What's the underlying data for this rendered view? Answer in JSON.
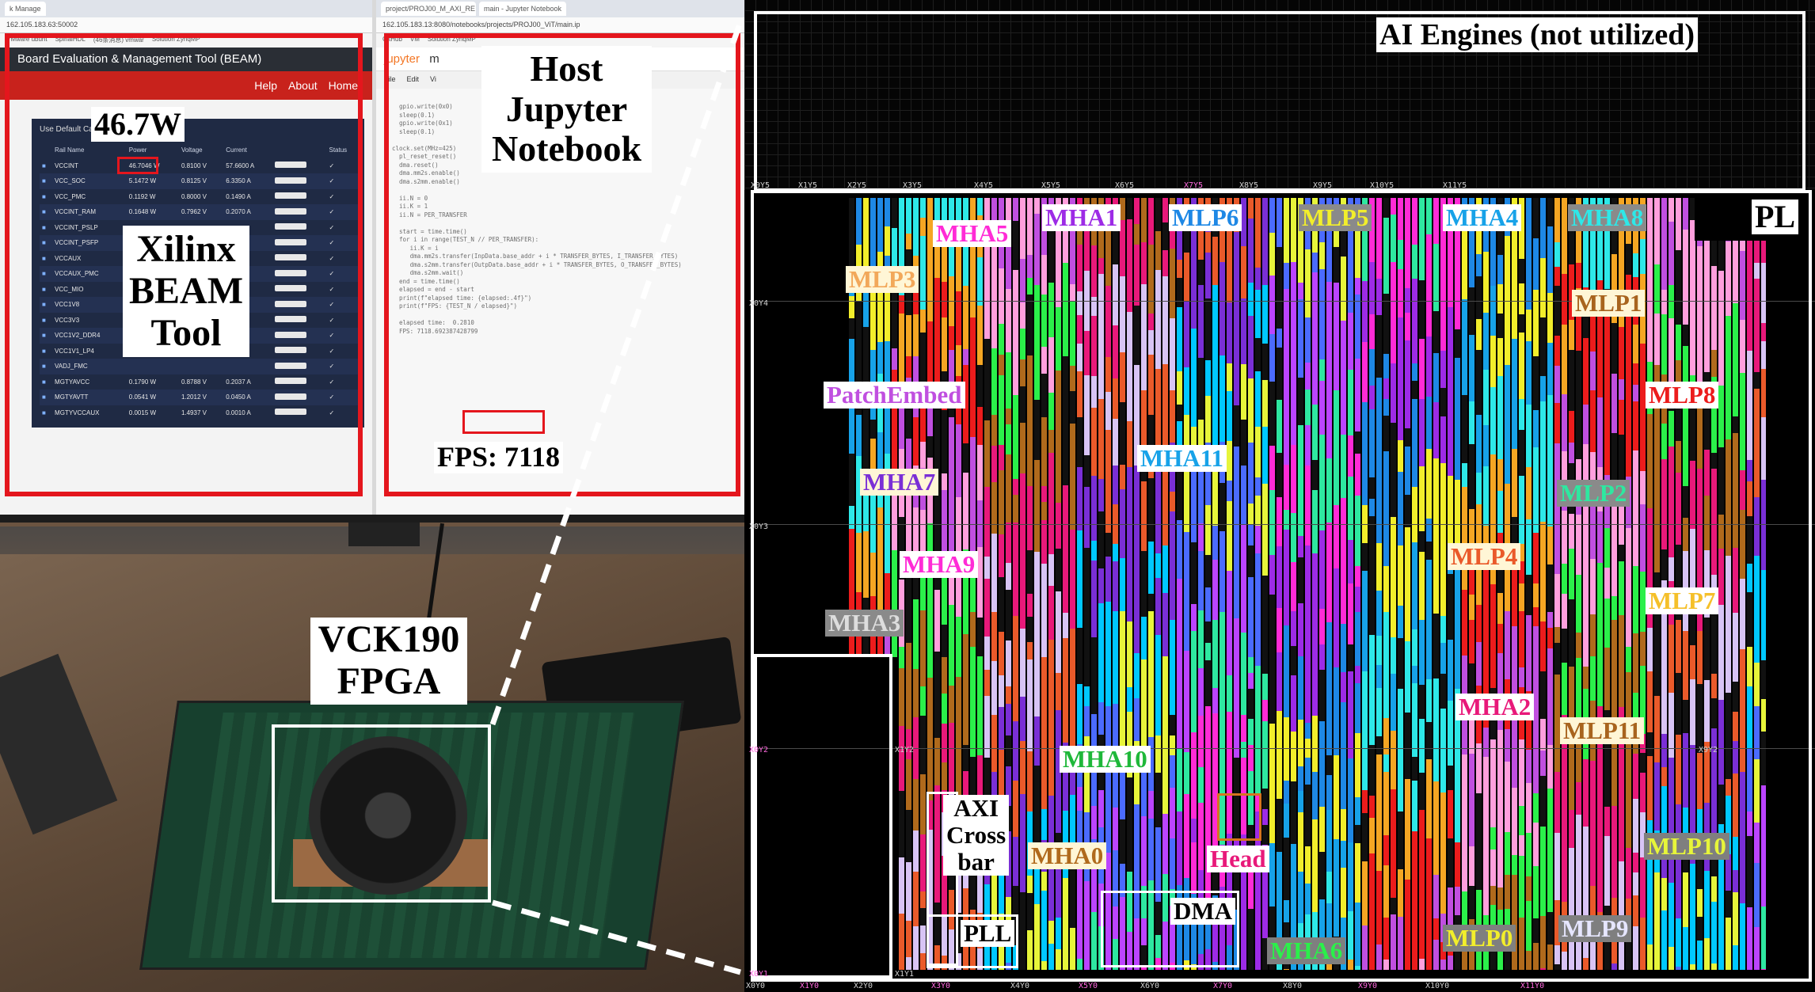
{
  "beam": {
    "tabs": [
      "k Manage",
      "Manage"
    ],
    "url": "162.105.183.63:50002",
    "bookmarks": [
      "VMware ubunt",
      "SpinalHDL",
      "(46条消息) vmwar",
      "Solution ZynqMP"
    ],
    "header": "Board Evaluation & Management Tool (BEAM)",
    "nav": [
      "Help",
      "About",
      "Home"
    ],
    "use_default": "Use Default Ca",
    "columns": [
      "Rail Name",
      "Power",
      "Voltage",
      "Current",
      "",
      "Status"
    ],
    "rows": [
      [
        "VCCINT",
        "46.7046 W",
        "0.8100 V",
        "57.6600 A"
      ],
      [
        "VCC_SOC",
        "5.1472 W",
        "0.8125 V",
        "6.3350 A"
      ],
      [
        "VCC_PMC",
        "0.1192 W",
        "0.8000 V",
        "0.1490 A"
      ],
      [
        "VCCINT_RAM",
        "0.1648 W",
        "0.7962 V",
        "0.2070 A"
      ],
      [
        "VCCINT_PSLP",
        "",
        "",
        ""
      ],
      [
        "VCCINT_PSFP",
        "",
        "",
        ""
      ],
      [
        "VCCAUX",
        "",
        "",
        ""
      ],
      [
        "VCCAUX_PMC",
        "",
        "",
        ""
      ],
      [
        "VCC_MIO",
        "",
        "",
        ""
      ],
      [
        "VCC1V8",
        "",
        "",
        ""
      ],
      [
        "VCC3V3",
        "",
        "",
        ""
      ],
      [
        "VCC1V2_DDR4",
        "",
        "",
        ""
      ],
      [
        "VCC1V1_LP4",
        "",
        "",
        ""
      ],
      [
        "VADJ_FMC",
        "",
        "",
        ""
      ],
      [
        "MGTYAVCC",
        "0.1790 W",
        "0.8788 V",
        "0.2037 A"
      ],
      [
        "MGTYAVTT",
        "0.0541 W",
        "1.2012 V",
        "0.0450 A"
      ],
      [
        "MGTYVCCAUX",
        "0.0015 W",
        "1.4937 V",
        "0.0010 A"
      ]
    ]
  },
  "jupyter": {
    "tabs": [
      "project/PROJ00_M_AXI_RE",
      "main - Jupyter Notebook"
    ],
    "url": "162.105.183.13:8080/notebooks/projects/PROJ00_ViT/main.ip",
    "bookmarks": [
      "GitHub",
      "VM",
      "Solution ZynqMP"
    ],
    "logo": "jupyter",
    "title_short": "m",
    "menu": [
      "File",
      "Edit",
      "Vi"
    ],
    "code": "  gpio.write(0x0)\n  sleep(0.1)\n  gpio.write(0x1)\n  sleep(0.1)\n\nclock.set(MHz=425)\n  pl_reset_reset()\n  dma.reset()\n  dma.mm2s.enable()\n  dma.s2mm.enable()\n\n  ii.N = 0\n  ii.K = 1\n  ii.N = PER_TRANSFER\n\n  start = time.time()\n  for i in range(TEST_N // PER_TRANSFER):\n     ii.K = i\n     dma.mm2s.transfer(InpData.base_addr + i * TRANSFER_BYTES, I_TRANSFER_BYTES)\n     dma.s2mm.transfer(OutpData.base_addr + i * TRANSFER_BYTES, O_TRANSFER_BYTES)\n     dma.s2mm.wait()\n  end = time.time()\n  elapsed = end - start\n  print(f\"elapsed time: {elapsed:.4f}\")\n  print(f\"FPS: {TEST_N / elapsed}\")\n\n  elapsed time:  0.2810\n  FPS: 7118.692387428799"
  },
  "annotations": {
    "power": "46.7W",
    "beam_tool": [
      "Xilinx",
      "BEAM",
      "Tool"
    ],
    "host": [
      "Host",
      "Jupyter",
      "Notebook"
    ],
    "fps": "FPS: 7118",
    "fpga": [
      "VCK190",
      "FPGA"
    ]
  },
  "floorplan": {
    "ai_engines": "AI Engines (not utilized)",
    "pl": "PL",
    "y5_coords": [
      "X0Y5",
      "X1Y5",
      "X2Y5",
      "X3Y5",
      "X4Y5",
      "X5Y5",
      "X6Y5",
      "X7Y5",
      "X8Y5",
      "X9Y5",
      "X10Y5",
      "X11Y5"
    ],
    "side_coords": [
      "X0Y4",
      "X0Y3",
      "X0Y2",
      "X1Y2",
      "X9Y2",
      "X0Y1",
      "X1Y1"
    ],
    "bottom_coords": [
      "X0Y0",
      "X1Y0",
      "X2Y0",
      "X3Y0",
      "X4Y0",
      "X5Y0",
      "X6Y0",
      "X7Y0",
      "X8Y0",
      "X9Y0",
      "X10Y0",
      "X11Y0"
    ],
    "labels": {
      "mha5": "MHA5",
      "mha1": "MHA1",
      "mlp6": "MLP6",
      "mlp5": "MLP5",
      "mha4": "MHA4",
      "mha8": "MHA8",
      "mlp3": "MLP3",
      "mlp1": "MLP1",
      "patch": "PatchEmbed",
      "mlp8": "MLP8",
      "mha11": "MHA11",
      "mha7": "MHA7",
      "mlp2": "MLP2",
      "mha9": "MHA9",
      "mlp4": "MLP4",
      "mlp7": "MLP7",
      "mha3": "MHA3",
      "mha2": "MHA2",
      "mlp11": "MLP11",
      "mha10": "MHA10",
      "axi": [
        "AXI",
        "Cross",
        "bar"
      ],
      "mha0": "MHA0",
      "head": "Head",
      "mlp10": "MLP10",
      "dma": "DMA",
      "pll": "PLL",
      "mlp0": "MLP0",
      "mlp9": "MLP9",
      "mha6": "MHA6"
    }
  },
  "colors": {
    "annotation_red": "#e4161d",
    "beam_red": "#c8221c"
  }
}
